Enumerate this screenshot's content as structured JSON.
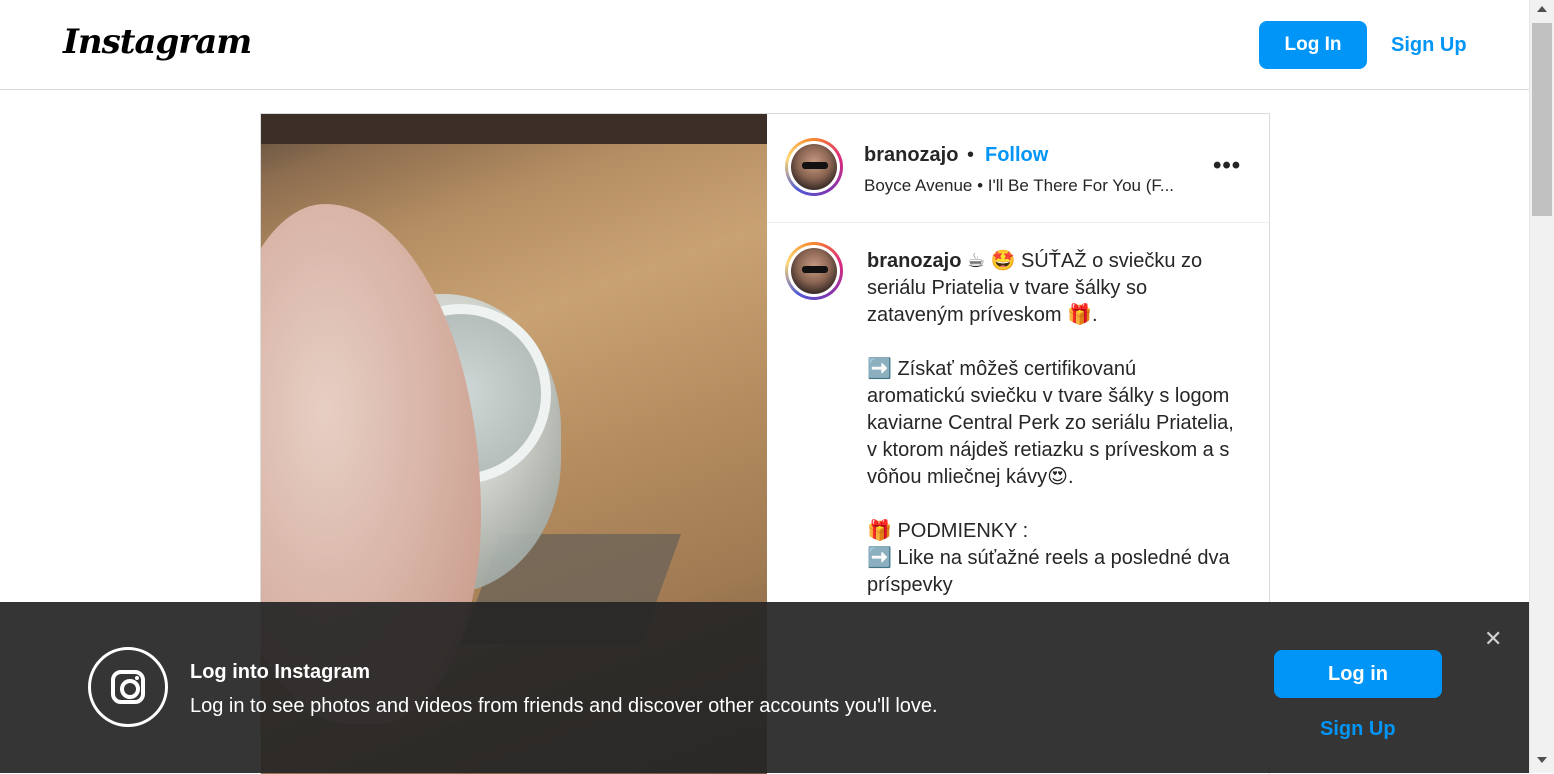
{
  "header": {
    "logo": "Instagram",
    "login_label": "Log In",
    "signup_label": "Sign Up"
  },
  "post": {
    "username": "branozajo",
    "separator": "•",
    "follow_label": "Follow",
    "audio": "Boyce Avenue • I'll Be There For You (F...",
    "more": "•••",
    "caption": {
      "username": "branozajo",
      "line1": " ☕ 🤩 SÚŤAŽ o sviečku zo seriálu Priatelia v tvare šálky so zataveným príveskom 🎁.",
      "para2": "➡️ Získať môžeš certifikovanú aromatickú sviečku v tvare šálky s logom kaviarne Central Perk zo seriálu Priatelia, v ktorom nájdeš retiazku s príveskom a s vôňou mliečnej kávy😍.",
      "para3_line1": "🎁 PODMIENKY :",
      "para3_line2": "➡️ Like na súťažné reels a posledné dva príspevky"
    }
  },
  "banner": {
    "title": "Log into Instagram",
    "text": "Log in to see photos and videos from friends and discover other accounts you'll love.",
    "close": "✕",
    "login_label": "Log in",
    "signup_label": "Sign Up"
  }
}
